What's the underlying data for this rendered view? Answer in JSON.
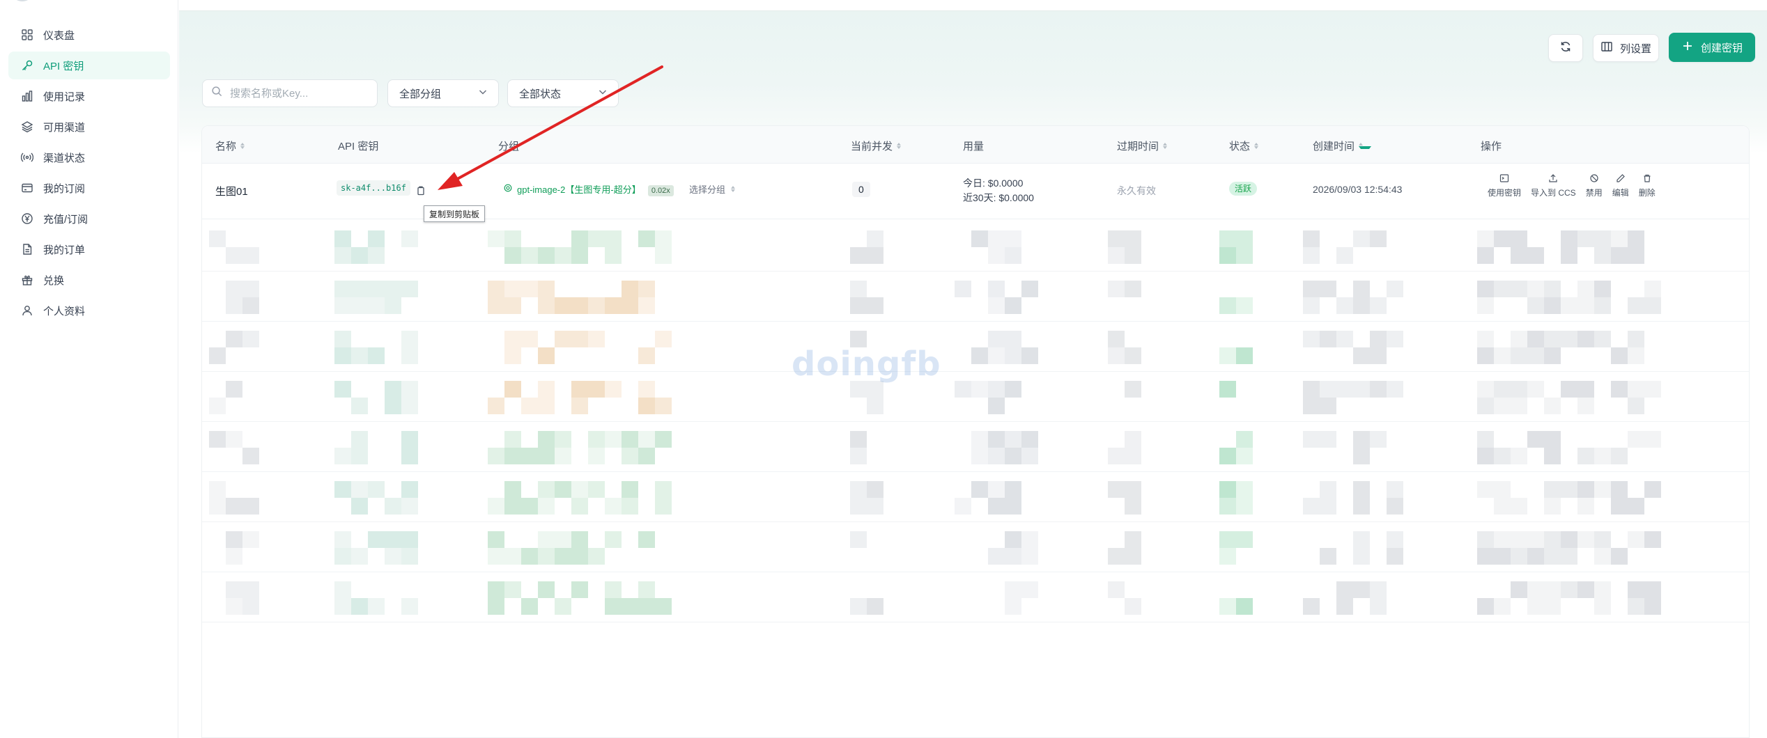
{
  "sidebar": {
    "items": [
      {
        "label": "仪表盘",
        "icon": "dashboard-icon"
      },
      {
        "label": "API 密钥",
        "icon": "key-icon",
        "active": true
      },
      {
        "label": "使用记录",
        "icon": "chart-icon"
      },
      {
        "label": "可用渠道",
        "icon": "layers-icon"
      },
      {
        "label": "渠道状态",
        "icon": "signal-icon"
      },
      {
        "label": "我的订阅",
        "icon": "card-icon"
      },
      {
        "label": "充值/订阅",
        "icon": "yen-icon"
      },
      {
        "label": "我的订单",
        "icon": "document-icon"
      },
      {
        "label": "兑换",
        "icon": "gift-icon"
      },
      {
        "label": "个人资料",
        "icon": "user-icon"
      }
    ]
  },
  "toolbar": {
    "columns_label": "列设置",
    "create_label": "创建密钥"
  },
  "filters": {
    "search_placeholder": "搜索名称或Key...",
    "group_value": "全部分组",
    "status_value": "全部状态"
  },
  "table": {
    "headers": {
      "name": "名称",
      "key": "API 密钥",
      "group": "分组",
      "concurrency": "当前并发",
      "usage": "用量",
      "expiry": "过期时间",
      "status": "状态",
      "created": "创建时间",
      "actions": "操作"
    },
    "row": {
      "name": "生图01",
      "key": "sk-a4f...b16f",
      "group_name": "gpt-image-2【生图专用-超分】",
      "ratio": "0.02x",
      "choose_group": "选择分组",
      "concurrency": "0",
      "usage_today": "今日: $0.0000",
      "usage_30d": "近30天: $0.0000",
      "expiry": "永久有效",
      "status": "活跃",
      "created": "2026/09/03 12:54:43",
      "actions": [
        "使用密钥",
        "导入到 CCS",
        "禁用",
        "编辑",
        "删除"
      ]
    }
  },
  "tooltip": "复制到剪贴板",
  "watermark": "doingfb",
  "colors": {
    "accent": "#13a483",
    "arrow": "#e02424"
  }
}
